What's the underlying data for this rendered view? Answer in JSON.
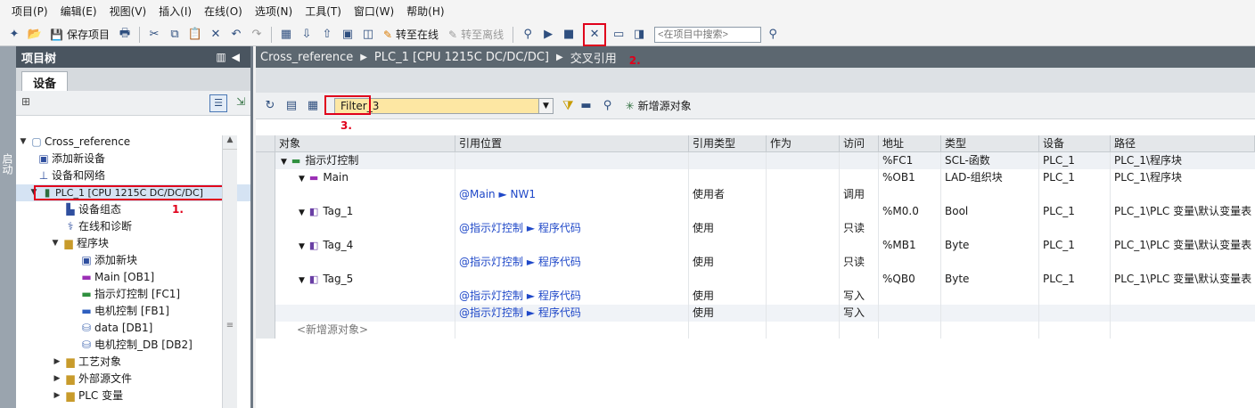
{
  "menu": [
    "项目(P)",
    "编辑(E)",
    "视图(V)",
    "插入(I)",
    "在线(O)",
    "选项(N)",
    "工具(T)",
    "窗口(W)",
    "帮助(H)"
  ],
  "toolbar": {
    "save_label": "保存项目",
    "go_online": "转至在线",
    "go_offline": "转至离线",
    "search_placeholder": "<在项目中搜索>"
  },
  "left_strip": {
    "label": "启动"
  },
  "tree": {
    "title": "项目树",
    "tab": "设备",
    "items": [
      {
        "label": "Cross_reference",
        "icon": "project-icon"
      },
      {
        "label": "添加新设备",
        "icon": "add-device-icon"
      },
      {
        "label": "设备和网络",
        "icon": "network-icon"
      },
      {
        "label": "PLC_1 [CPU 1215C DC/DC/DC]",
        "icon": "plc-icon"
      },
      {
        "label": "设备组态",
        "icon": "device-config-icon"
      },
      {
        "label": "在线和诊断",
        "icon": "diagnostics-icon"
      },
      {
        "label": "程序块",
        "icon": "folder-icon"
      },
      {
        "label": "添加新块",
        "icon": "add-block-icon"
      },
      {
        "label": "Main [OB1]",
        "icon": "ob-icon"
      },
      {
        "label": "指示灯控制 [FC1]",
        "icon": "fc-icon"
      },
      {
        "label": "电机控制 [FB1]",
        "icon": "fb-icon"
      },
      {
        "label": "data [DB1]",
        "icon": "db-icon"
      },
      {
        "label": "电机控制_DB [DB2]",
        "icon": "db-icon"
      },
      {
        "label": "工艺对象",
        "icon": "folder-icon"
      },
      {
        "label": "外部源文件",
        "icon": "folder-icon"
      },
      {
        "label": "PLC 变量",
        "icon": "folder-icon"
      }
    ]
  },
  "annotations": {
    "a1": "1.",
    "a2": "2.",
    "a3": "3."
  },
  "breadcrumb": [
    "Cross_reference",
    "PLC_1 [CPU 1215C DC/DC/DC]",
    "交叉引用"
  ],
  "main_toolbar": {
    "filter_value": "Filter_3",
    "add_source_label": "新增源对象"
  },
  "grid": {
    "columns": [
      "对象",
      "引用位置",
      "引用类型",
      "作为",
      "访问",
      "地址",
      "类型",
      "设备",
      "路径"
    ],
    "rows": [
      {
        "obj": "指示灯控制",
        "loc": "",
        "rtype": "",
        "as": "",
        "access": "",
        "addr": "%FC1",
        "type": "SCL-函数",
        "dev": "PLC_1",
        "path": "PLC_1\\程序块"
      },
      {
        "obj": "Main",
        "loc": "",
        "rtype": "",
        "as": "",
        "access": "",
        "addr": "%OB1",
        "type": "LAD-组织块",
        "dev": "PLC_1",
        "path": "PLC_1\\程序块"
      },
      {
        "obj": "",
        "loc": "@Main ► NW1",
        "rtype": "使用者",
        "as": "",
        "access": "调用",
        "addr": "",
        "type": "",
        "dev": "",
        "path": ""
      },
      {
        "obj": "Tag_1",
        "loc": "",
        "rtype": "",
        "as": "",
        "access": "",
        "addr": "%M0.0",
        "type": "Bool",
        "dev": "PLC_1",
        "path": "PLC_1\\PLC 变量\\默认变量表"
      },
      {
        "obj": "",
        "loc": "@指示灯控制 ► 程序代码",
        "rtype": "使用",
        "as": "",
        "access": "只读",
        "addr": "",
        "type": "",
        "dev": "",
        "path": ""
      },
      {
        "obj": "Tag_4",
        "loc": "",
        "rtype": "",
        "as": "",
        "access": "",
        "addr": "%MB1",
        "type": "Byte",
        "dev": "PLC_1",
        "path": "PLC_1\\PLC 变量\\默认变量表"
      },
      {
        "obj": "",
        "loc": "@指示灯控制 ► 程序代码",
        "rtype": "使用",
        "as": "",
        "access": "只读",
        "addr": "",
        "type": "",
        "dev": "",
        "path": ""
      },
      {
        "obj": "Tag_5",
        "loc": "",
        "rtype": "",
        "as": "",
        "access": "",
        "addr": "%QB0",
        "type": "Byte",
        "dev": "PLC_1",
        "path": "PLC_1\\PLC 变量\\默认变量表"
      },
      {
        "obj": "",
        "loc": "@指示灯控制 ► 程序代码",
        "rtype": "使用",
        "as": "",
        "access": "写入",
        "addr": "",
        "type": "",
        "dev": "",
        "path": ""
      },
      {
        "obj": "",
        "loc": "@指示灯控制 ► 程序代码",
        "rtype": "使用",
        "as": "",
        "access": "写入",
        "addr": "",
        "type": "",
        "dev": "",
        "path": ""
      },
      {
        "obj": "<新增源对象>",
        "loc": "",
        "rtype": "",
        "as": "",
        "access": "",
        "addr": "",
        "type": "",
        "dev": "",
        "path": ""
      }
    ]
  },
  "colors": {
    "annotation": "#e0001b",
    "link": "#1f48c8",
    "filter_bg": "#fde7a3",
    "header_dark": "#4a5560"
  }
}
